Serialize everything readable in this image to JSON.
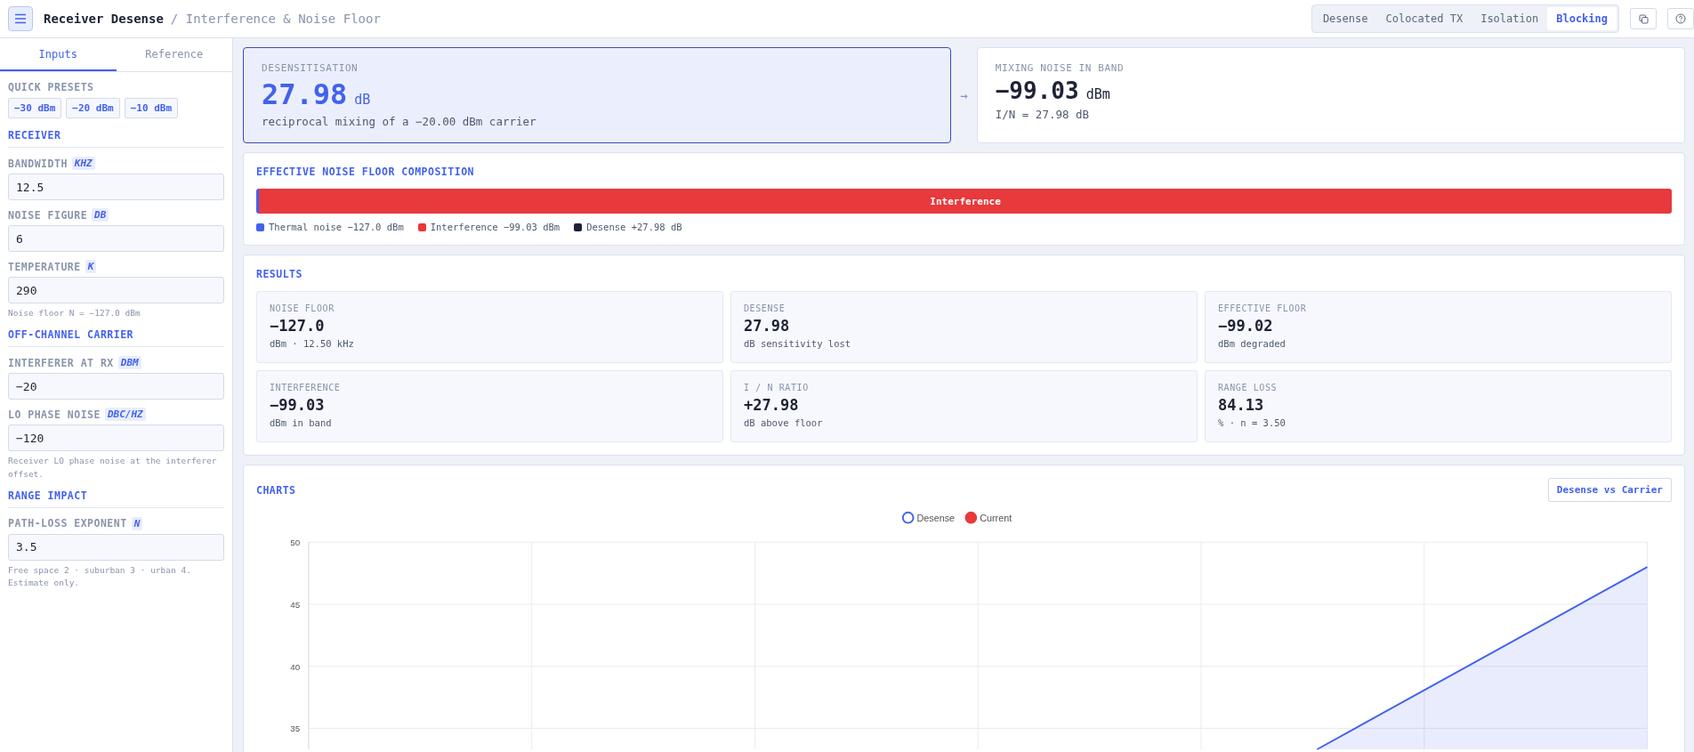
{
  "header": {
    "title": "Receiver Desense",
    "subtitle": "/ Interference & Noise Floor",
    "tabs": [
      {
        "label": "Desense",
        "selected": false
      },
      {
        "label": "Colocated TX",
        "selected": false
      },
      {
        "label": "Isolation",
        "selected": false
      },
      {
        "label": "Blocking",
        "selected": true
      }
    ]
  },
  "sidebar": {
    "tabs": [
      {
        "label": "Inputs",
        "selected": true
      },
      {
        "label": "Reference",
        "selected": false
      }
    ],
    "presets": {
      "label": "QUICK PRESETS",
      "items": [
        "−30 dBm",
        "−20 dBm",
        "−10 dBm"
      ]
    },
    "sections": [
      {
        "title": "RECEIVER",
        "fields": [
          {
            "label": "BANDWIDTH",
            "unit": "KHZ",
            "value": "12.5"
          },
          {
            "label": "NOISE FIGURE",
            "unit": "DB",
            "value": "6"
          },
          {
            "label": "TEMPERATURE",
            "unit": "K",
            "value": "290",
            "hint": "Noise floor N = −127.0 dBm"
          }
        ]
      },
      {
        "title": "OFF-CHANNEL CARRIER",
        "fields": [
          {
            "label": "INTERFERER AT RX",
            "unit": "DBM",
            "value": "−20"
          },
          {
            "label": "LO PHASE NOISE",
            "unit": "DBC/HZ",
            "value": "−120",
            "hint": "Receiver LO phase noise at the interferer offset."
          }
        ]
      },
      {
        "title": "RANGE IMPACT",
        "fields": [
          {
            "label": "PATH-LOSS EXPONENT",
            "unit": "N",
            "value": "3.5",
            "hint": "Free space 2 · suburban 3 · urban 4. Estimate only."
          }
        ]
      }
    ]
  },
  "summary": {
    "primary": {
      "label": "DESENSITISATION",
      "value": "27.98",
      "unit": "dB",
      "note": "reciprocal mixing of a −20.00 dBm carrier"
    },
    "arrow": "→",
    "secondary": {
      "label": "MIXING NOISE IN BAND",
      "value": "−99.03",
      "unit": "dBm",
      "note": "I/N = 27.98 dB"
    }
  },
  "composition": {
    "title": "EFFECTIVE NOISE FLOOR COMPOSITION",
    "segments": [
      {
        "color": "#4361ee",
        "level": 0.002
      },
      {
        "label": "Interference",
        "color": "#e8393c",
        "level": 0.998
      }
    ],
    "legend": [
      {
        "label": "Thermal noise −127.0 dBm",
        "color": "#4361ee"
      },
      {
        "label": "Interference −99.03 dBm",
        "color": "#e8393c"
      },
      {
        "label": "Desense +27.98 dB",
        "color": "#1e2235"
      }
    ]
  },
  "results": {
    "title": "RESULTS",
    "metrics": [
      {
        "label": "NOISE FLOOR",
        "value": "−127.0",
        "sub": "dBm · 12.50 kHz"
      },
      {
        "label": "DESENSE",
        "value": "27.98",
        "sub": "dB sensitivity lost"
      },
      {
        "label": "EFFECTIVE FLOOR",
        "value": "−99.02",
        "sub": "dBm degraded"
      },
      {
        "label": "INTERFERENCE",
        "value": "−99.03",
        "sub": "dBm in band"
      },
      {
        "label": "I / N RATIO",
        "value": "+27.98",
        "sub": "dB above floor"
      },
      {
        "label": "RANGE LOSS",
        "value": "84.13",
        "sub": "% · n = 3.50"
      }
    ]
  },
  "charts": {
    "title": "CHARTS",
    "button": "Desense vs Carrier",
    "chart": {
      "legend": [
        {
          "name": "Desense",
          "color": "#4361ee",
          "kind": "ring"
        },
        {
          "name": "Current",
          "color": "#e8393c",
          "kind": "disc"
        }
      ],
      "y_labels": [
        "50",
        "45",
        "40",
        "35"
      ]
    }
  }
}
